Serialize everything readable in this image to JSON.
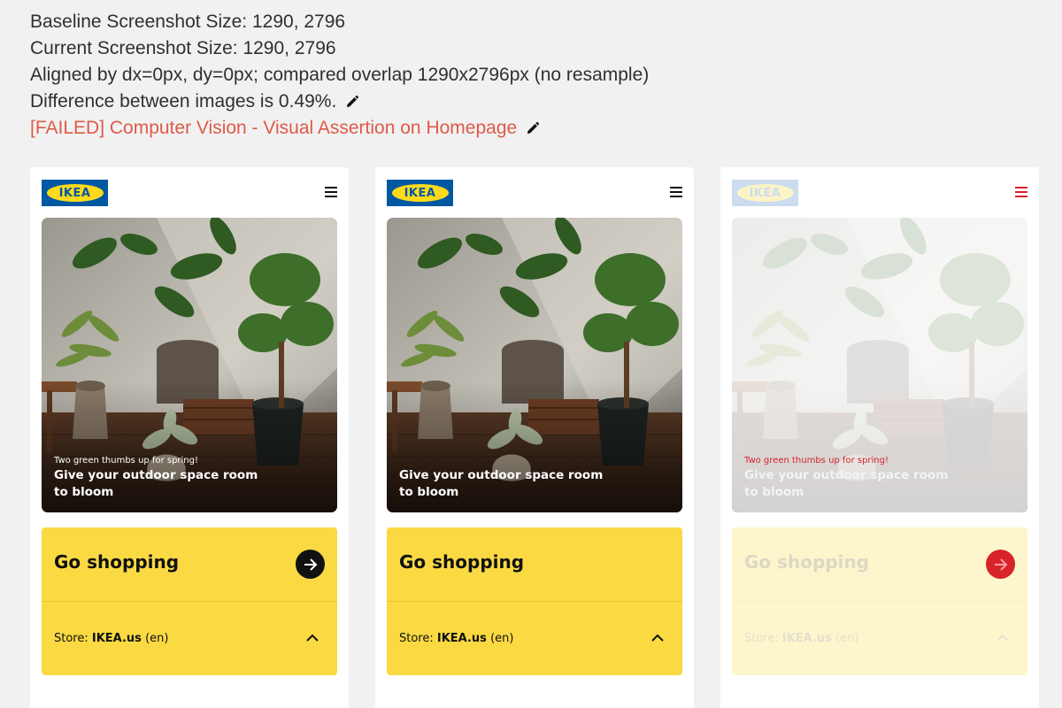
{
  "report": {
    "baseline_size": "Baseline Screenshot Size: 1290, 2796",
    "current_size": "Current Screenshot Size: 1290, 2796",
    "alignment": "Aligned by dx=0px, dy=0px; compared overlap 1290x2796px (no resample)",
    "difference": "Difference between images is 0.49%.",
    "status_title": "[FAILED] Computer Vision - Visual Assertion on Homepage"
  },
  "colors": {
    "failed_text": "#e05a47",
    "ikea_blue": "#0058a3",
    "ikea_yellow": "#ffda1a",
    "card_yellow": "#fad943",
    "diff_red": "#d8232a"
  },
  "panels": [
    {
      "variant": "baseline",
      "logo_text": "IKEA",
      "hero_subtitle": "Two green thumbs up for spring!",
      "hero_title": "Give your outdoor space room to bloom",
      "shop_title": "Go shopping",
      "store_label": "Store:",
      "store_name": "IKEA.us",
      "store_lang": "(en)",
      "icons": [
        "menu-icon",
        "arrow-right-icon",
        "chevron-up-icon"
      ]
    },
    {
      "variant": "current",
      "logo_text": "IKEA",
      "hero_subtitle": "",
      "hero_title": "Give your outdoor space room to bloom",
      "shop_title": "Go shopping",
      "store_label": "Store:",
      "store_name": "IKEA.us",
      "store_lang": "(en)",
      "icons": [
        "menu-icon",
        "chevron-up-icon"
      ]
    },
    {
      "variant": "diff",
      "logo_text": "IKEA",
      "hero_subtitle": "Two green thumbs up for spring!",
      "hero_title": "Give your outdoor space room to bloom",
      "shop_title": "Go shopping",
      "store_label": "Store:",
      "store_name": "IKEA.us",
      "store_lang": "(en)",
      "icons": [
        "menu-icon",
        "arrow-right-icon",
        "chevron-up-icon"
      ]
    }
  ]
}
